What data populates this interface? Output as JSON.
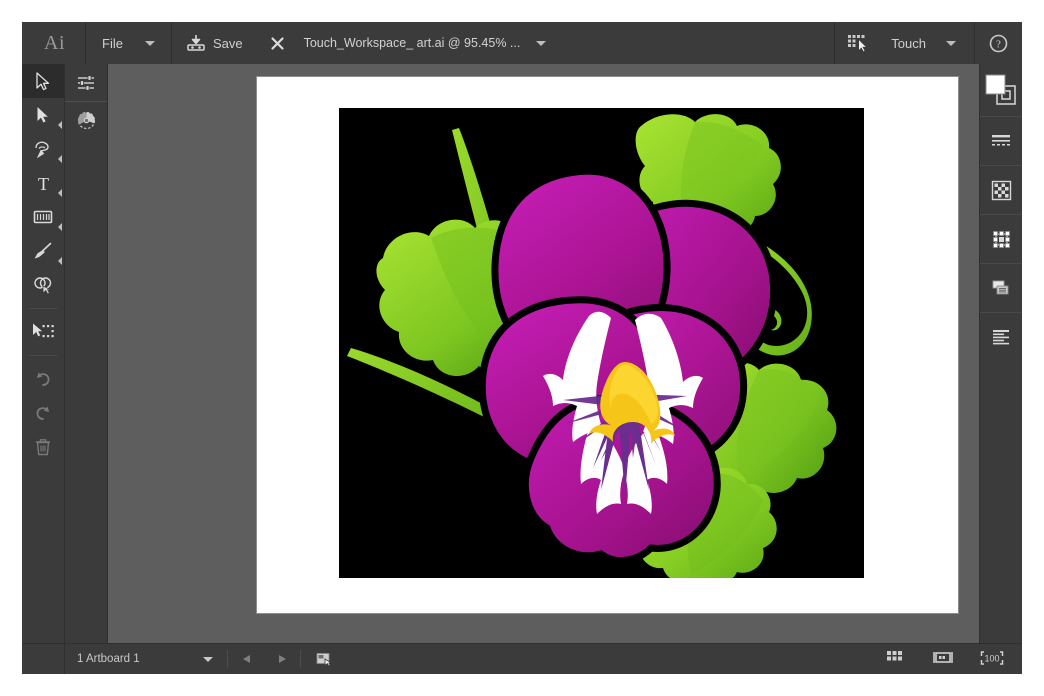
{
  "app": {
    "name": "Adobe Illustrator",
    "logo_text": "Ai",
    "chrome_bg": "#3b3b3b",
    "canvas_bg": "#5e5e5e",
    "page_bg": "#535353"
  },
  "topbar": {
    "logo": "Ai",
    "menu_label": "File",
    "menu_caret_icon": "chevron-down-icon",
    "save_label": "Save",
    "save_icon": "save-disk-icon",
    "close_icon": "close-x-icon",
    "document_tab": "Touch_Workspace_ art.ai @ 95.45% ...",
    "tab_caret_icon": "chevron-down-icon",
    "touch_mode_icon": "touch-cursor-icon",
    "workspace_label": "Touch",
    "workspace_caret_icon": "chevron-down-icon",
    "help_icon": "help-question-icon"
  },
  "toolbar": {
    "tools": [
      {
        "name": "selection-tool",
        "icon": "arrow-outline-icon",
        "selected": true,
        "has_flyout": false,
        "dim": false
      },
      {
        "name": "direct-selection-tool",
        "icon": "arrow-solid-icon",
        "selected": false,
        "has_flyout": true,
        "dim": false
      },
      {
        "name": "pen-tool",
        "icon": "pen-nib-icon",
        "selected": false,
        "has_flyout": true,
        "dim": false
      },
      {
        "name": "type-tool",
        "icon": "type-t-icon",
        "selected": false,
        "has_flyout": true,
        "dim": false
      },
      {
        "name": "shape-tool",
        "icon": "rectangle-icon",
        "selected": false,
        "has_flyout": true,
        "dim": false
      },
      {
        "name": "paintbrush-tool",
        "icon": "paintbrush-icon",
        "selected": false,
        "has_flyout": true,
        "dim": false
      },
      {
        "name": "shape-builder-tool",
        "icon": "shape-builder-icon",
        "selected": false,
        "has_flyout": false,
        "dim": false
      },
      {
        "name": "free-transform-tool",
        "icon": "transform-marquee-icon",
        "selected": false,
        "has_flyout": false,
        "dim": false
      },
      {
        "name": "undo-button",
        "icon": "undo-arrow-icon",
        "selected": false,
        "has_flyout": false,
        "dim": true
      },
      {
        "name": "redo-button",
        "icon": "redo-arrow-icon",
        "selected": false,
        "has_flyout": false,
        "dim": true
      },
      {
        "name": "delete-button",
        "icon": "trash-can-icon",
        "selected": false,
        "has_flyout": false,
        "dim": true
      }
    ]
  },
  "toolbar_secondary": {
    "items": [
      {
        "name": "properties-panel-button",
        "icon": "sliders-icon"
      },
      {
        "name": "color-panel-button",
        "icon": "color-wheel-icon"
      }
    ]
  },
  "right_panel": {
    "items": [
      {
        "name": "fill-stroke-swatch",
        "icon": "fill-stroke-swatch-icon",
        "fill": "#ffffff",
        "stroke": "#000000"
      },
      {
        "name": "stroke-panel-button",
        "icon": "stroke-lines-icon"
      },
      {
        "name": "swatches-panel-button",
        "icon": "checker-grid-icon"
      },
      {
        "name": "transform-panel-button",
        "icon": "bounding-box-handles-icon"
      },
      {
        "name": "layers-panel-button",
        "icon": "layers-icon"
      },
      {
        "name": "align-panel-button",
        "icon": "align-lines-icon"
      }
    ]
  },
  "statusbar": {
    "artboard_label": "1 Artboard 1",
    "artboard_caret_icon": "chevron-down-icon",
    "prev_artboard_icon": "triangle-left-icon",
    "next_artboard_icon": "triangle-right-icon",
    "artboard_nav_icon": "artboard-nav-icon",
    "right_icons": [
      {
        "name": "grid-view-button",
        "icon": "grid-cells-icon"
      },
      {
        "name": "fit-artboard-button",
        "icon": "fit-artboard-icon"
      },
      {
        "name": "zoom-100-button",
        "icon": "zoom-100-icon",
        "label": "100"
      }
    ]
  },
  "artwork": {
    "title": "Pansy flower illustration",
    "background": "#000000",
    "colors": {
      "petal_magenta_light": "#c01bb0",
      "petal_magenta": "#a8138f",
      "petal_magenta_dark": "#8e0f78",
      "leaf_green_light": "#9ede2a",
      "leaf_green": "#79c41f",
      "leaf_green_dark": "#55a315",
      "stem_green": "#7fc62b",
      "center_yellow": "#f5c518",
      "center_purple": "#6b2e8f",
      "white": "#ffffff",
      "outline_black": "#000000"
    },
    "elements": [
      "upper-left-petal",
      "upper-right-petal",
      "middle-left-petal",
      "middle-right-petal",
      "lower-center-petal",
      "white-face-marking",
      "yellow-center",
      "purple-rays",
      "leaf-top-right",
      "leaf-left",
      "leaf-bottom-right",
      "leaf-lower-right",
      "stem-long-diagonal",
      "stem-curl-right",
      "stem-lower-left"
    ]
  }
}
